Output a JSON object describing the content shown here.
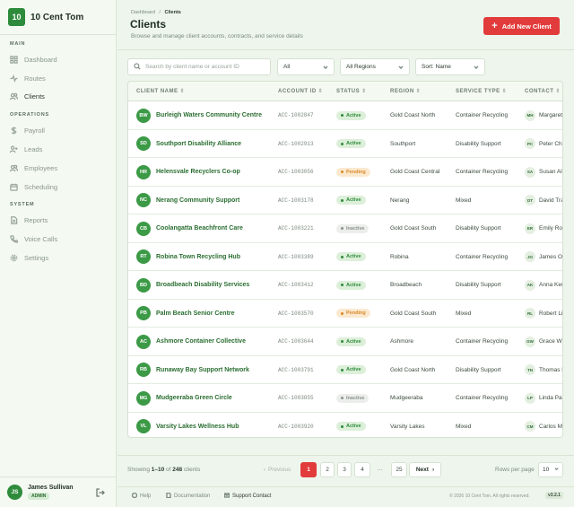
{
  "brand": {
    "logo": "10",
    "name": "10 Cent Tom"
  },
  "sidebar": {
    "sections": [
      {
        "label": "MAIN",
        "items": [
          {
            "label": "Dashboard",
            "icon": "grid-icon"
          },
          {
            "label": "Routes",
            "icon": "activity-icon"
          },
          {
            "label": "Clients",
            "icon": "users-icon"
          }
        ]
      },
      {
        "label": "OPERATIONS",
        "items": [
          {
            "label": "Payroll",
            "icon": "dollar-icon"
          },
          {
            "label": "Leads",
            "icon": "user-plus-icon"
          },
          {
            "label": "Employees",
            "icon": "users-icon"
          },
          {
            "label": "Scheduling",
            "icon": "calendar-icon"
          }
        ]
      },
      {
        "label": "SYSTEM",
        "items": [
          {
            "label": "Reports",
            "icon": "file-icon"
          },
          {
            "label": "Voice Calls",
            "icon": "phone-icon"
          },
          {
            "label": "Settings",
            "icon": "gear-icon"
          }
        ]
      }
    ],
    "user": {
      "initials": "JS",
      "name": "James Sullivan",
      "role": "ADMIN"
    }
  },
  "header": {
    "breadcrumb": {
      "root": "Dashboard",
      "sep": "/",
      "current": "Clients"
    },
    "title": "Clients",
    "subtitle": "Browse and manage client accounts, contracts, and service details",
    "add_button": "Add New Client"
  },
  "filters": {
    "search_placeholder": "Search by client name or account ID",
    "status": "All",
    "region": "All Regions",
    "sort": "Sort: Name"
  },
  "table": {
    "columns": [
      "CLIENT NAME",
      "ACCOUNT ID",
      "STATUS",
      "REGION",
      "SERVICE TYPE",
      "CONTACT"
    ],
    "status_colors": {
      "Active": {
        "bg": "#dcefd9",
        "fg": "#2e8b3b"
      },
      "Pending": {
        "bg": "#fbe9cf",
        "fg": "#d9892a"
      },
      "Inactive": {
        "bg": "#eceeec",
        "fg": "#8a948c"
      }
    },
    "rows": [
      {
        "initials": "BW",
        "name": "Burleigh Waters Community Centre",
        "account": "ACC-1002847",
        "status": "Active",
        "region": "Gold Coast North",
        "service": "Container Recycling",
        "contact_initials": "MH",
        "contact": "Margaret Hughes"
      },
      {
        "initials": "SD",
        "name": "Southport Disability Alliance",
        "account": "ACC-1002913",
        "status": "Active",
        "region": "Southport",
        "service": "Disability Support",
        "contact_initials": "PC",
        "contact": "Peter Chen"
      },
      {
        "initials": "HR",
        "name": "Helensvale Recyclers Co-op",
        "account": "ACC-1003056",
        "status": "Pending",
        "region": "Gold Coast Central",
        "service": "Container Recycling",
        "contact_initials": "SA",
        "contact": "Susan Allen"
      },
      {
        "initials": "NC",
        "name": "Nerang Community Support",
        "account": "ACC-1003178",
        "status": "Active",
        "region": "Nerang",
        "service": "Mixed",
        "contact_initials": "DT",
        "contact": "David Tran"
      },
      {
        "initials": "CB",
        "name": "Coolangatta Beachfront Care",
        "account": "ACC-1003221",
        "status": "Inactive",
        "region": "Gold Coast South",
        "service": "Disability Support",
        "contact_initials": "ER",
        "contact": "Emily Ross"
      },
      {
        "initials": "RT",
        "name": "Robina Town Recycling Hub",
        "account": "ACC-1003389",
        "status": "Active",
        "region": "Robina",
        "service": "Container Recycling",
        "contact_initials": "JO",
        "contact": "James Olsen"
      },
      {
        "initials": "BD",
        "name": "Broadbeach Disability Services",
        "account": "ACC-1003412",
        "status": "Active",
        "region": "Broadbeach",
        "service": "Disability Support",
        "contact_initials": "AK",
        "contact": "Anna Kew"
      },
      {
        "initials": "PB",
        "name": "Palm Beach Senior Centre",
        "account": "ACC-1003570",
        "status": "Pending",
        "region": "Gold Coast South",
        "service": "Mixed",
        "contact_initials": "RL",
        "contact": "Robert Lim"
      },
      {
        "initials": "AC",
        "name": "Ashmore Container Collective",
        "account": "ACC-1003644",
        "status": "Active",
        "region": "Ashmore",
        "service": "Container Recycling",
        "contact_initials": "GW",
        "contact": "Grace Wilson"
      },
      {
        "initials": "RB",
        "name": "Runaway Bay Support Network",
        "account": "ACC-1003791",
        "status": "Active",
        "region": "Gold Coast North",
        "service": "Disability Support",
        "contact_initials": "TN",
        "contact": "Thomas Nash"
      },
      {
        "initials": "MG",
        "name": "Mudgeeraba Green Circle",
        "account": "ACC-1003855",
        "status": "Inactive",
        "region": "Mudgeeraba",
        "service": "Container Recycling",
        "contact_initials": "LP",
        "contact": "Linda Park"
      },
      {
        "initials": "VL",
        "name": "Varsity Lakes Wellness Hub",
        "account": "ACC-1003920",
        "status": "Active",
        "region": "Varsity Lakes",
        "service": "Mixed",
        "contact_initials": "CM",
        "contact": "Carlos Mendes"
      }
    ]
  },
  "pagination": {
    "showing_prefix": "Showing",
    "range": "1–10",
    "of": "of",
    "total": "248",
    "suffix": "clients",
    "previous": "Previous",
    "pages": [
      "1",
      "2",
      "3",
      "4"
    ],
    "ellipsis": "…",
    "last_page": "25",
    "next": "Next",
    "current_page": "1",
    "rows_per_page_label": "Rows per page",
    "rows_per_page": "10"
  },
  "footer": {
    "help": "Help",
    "docs": "Documentation",
    "support": "Support Contact",
    "copyright": "© 2026 10 Cent Tom. All rights reserved.",
    "version": "v3.2.1"
  },
  "colors": {
    "brand": "#2e8b3b",
    "accent": "#e23b3b"
  }
}
